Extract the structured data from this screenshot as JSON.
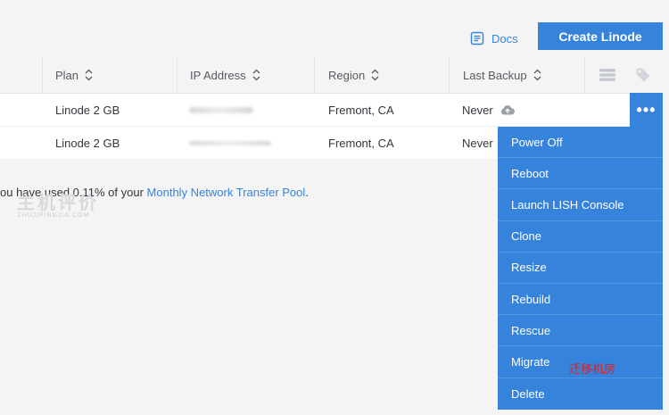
{
  "header": {
    "docs_label": "Docs",
    "create_label": "Create Linode"
  },
  "table": {
    "columns": [
      "Plan",
      "IP Address",
      "Region",
      "Last Backup"
    ],
    "rows": [
      {
        "plan": "Linode 2 GB",
        "ip": "",
        "region": "Fremont, CA",
        "backup": "Never"
      },
      {
        "plan": "Linode 2 GB",
        "ip": "",
        "region": "Fremont, CA",
        "backup": "Never"
      }
    ]
  },
  "actions_label": "•••",
  "transfer": {
    "prefix": "ou have used 0.11% of your ",
    "link": "Monthly Network Transfer Pool",
    "suffix": "."
  },
  "watermark": {
    "big": "主机评价",
    "small": "ZHUJIPINGJIA.COM"
  },
  "menu": {
    "items": [
      "Power Off",
      "Reboot",
      "Launch LISH Console",
      "Clone",
      "Resize",
      "Rebuild",
      "Rescue",
      "Migrate",
      "Delete"
    ]
  },
  "annotation": "迁移机房",
  "colors": {
    "accent": "#3683dc",
    "annotation": "#e02020",
    "background": "#f4f4f4"
  },
  "icons": {
    "docs": "document-icon",
    "sort": "sort-icon",
    "list": "list-view-icon",
    "tag": "tag-icon",
    "cloud": "cloud-upload-icon"
  }
}
